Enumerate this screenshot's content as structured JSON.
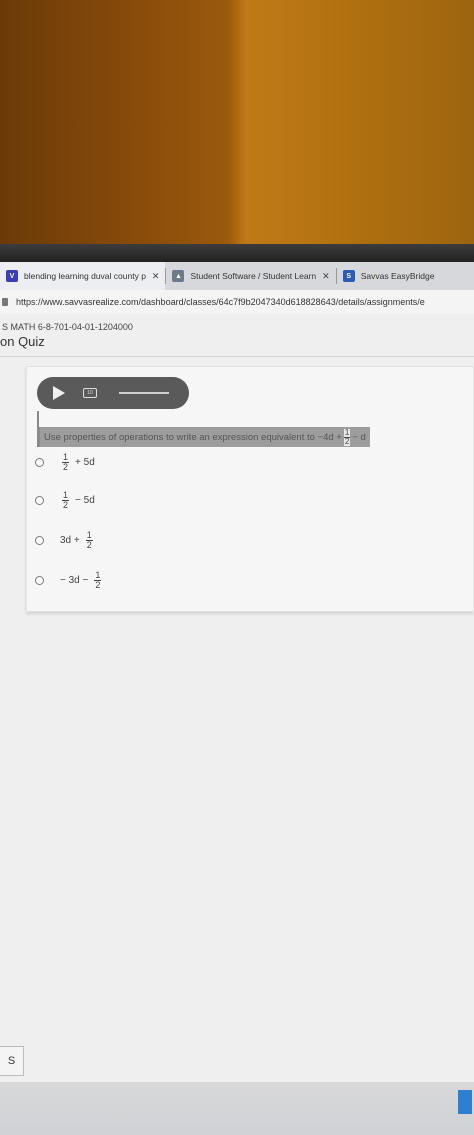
{
  "browser": {
    "tabs": [
      {
        "label": "blending learning duval county p",
        "icon": "blending-learning-icon",
        "active": true
      },
      {
        "label": "Student Software / Student Learn",
        "icon": "student-software-icon",
        "active": false
      },
      {
        "label": "Savvas EasyBridge",
        "icon": "savvas-icon",
        "active": false
      }
    ],
    "url": "https://www.savvasrealize.com/dashboard/classes/64c7f9b2047340d618828643/details/assignments/e"
  },
  "header": {
    "course_code": "S MATH 6-8-701-04-01-1204000",
    "quiz_title": "on Quiz"
  },
  "question": {
    "prompt": "Use properties of operations to write an expression equivalent to −4d +",
    "prompt_frac_num": "1",
    "prompt_frac_den": "2",
    "prompt_tail": "− d",
    "options": [
      {
        "pre": "",
        "num": "1",
        "den": "2",
        "post": "+ 5d"
      },
      {
        "pre": "",
        "num": "1",
        "den": "2",
        "post": "− 5d"
      },
      {
        "pre": "3d +",
        "num": "1",
        "den": "2",
        "post": ""
      },
      {
        "pre": "− 3d −",
        "num": "1",
        "den": "2",
        "post": ""
      }
    ]
  },
  "audio": {
    "replay_label": "10"
  },
  "bottom_button": {
    "label": "S"
  },
  "colors": {
    "prompt_highlight": "#9d9d9d",
    "audio_player": "#5a5a5a"
  }
}
